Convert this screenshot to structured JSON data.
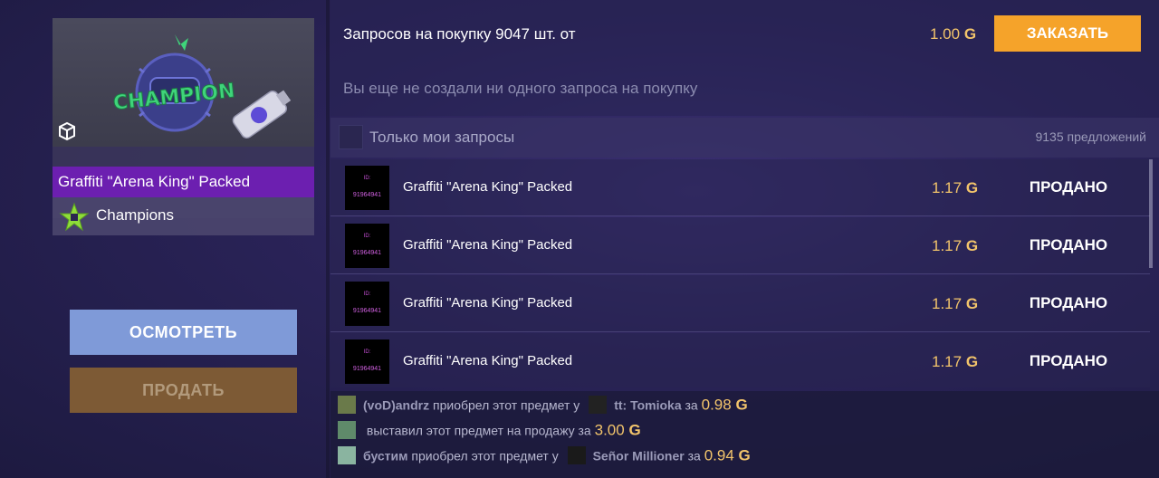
{
  "item": {
    "name": "Graffiti \"Arena King\" Packed",
    "collection": "Champions",
    "image_text": "CHAMPION"
  },
  "buttons": {
    "inspect": "ОСМОТРЕТЬ",
    "sell": "ПРОДАТЬ",
    "order": "ЗАКАЗАТЬ"
  },
  "request": {
    "label": "Запросов на покупку 9047 шт. от",
    "price": "1.00",
    "empty_text": "Вы еще не создали ни одного запроса на покупку"
  },
  "filter": {
    "label": "Только мои запросы",
    "offers_count": "9135 предложений"
  },
  "currency_symbol": "G",
  "colors": {
    "accent_orange": "#f5a32a",
    "gold": "#f2c46b",
    "rarity_purple": "#6c1fb0"
  },
  "listings": [
    {
      "thumb_id_label": "ID:",
      "thumb_id": "91964941",
      "name": "Graffiti \"Arena King\" Packed",
      "price": "1.17",
      "status": "ПРОДАНО"
    },
    {
      "thumb_id_label": "ID:",
      "thumb_id": "91964941",
      "name": "Graffiti \"Arena King\" Packed",
      "price": "1.17",
      "status": "ПРОДАНО"
    },
    {
      "thumb_id_label": "ID:",
      "thumb_id": "91964941",
      "name": "Graffiti \"Arena King\" Packed",
      "price": "1.17",
      "status": "ПРОДАНО"
    },
    {
      "thumb_id_label": "ID:",
      "thumb_id": "91964941",
      "name": "Graffiti \"Arena King\" Packed",
      "price": "1.17",
      "status": "ПРОДАНО"
    }
  ],
  "history": [
    {
      "user": "(voD)andrz",
      "action": "приобрел этот предмет у",
      "seller": "tt: Tomioka",
      "for_word": "за",
      "price": "0.98"
    },
    {
      "user": "",
      "action": "выставил этот предмет на продажу за",
      "price": "3.00"
    },
    {
      "user": "бустим",
      "action": "приобрел этот предмет у",
      "seller": "Señor Millioner",
      "for_word": "за",
      "price": "0.94"
    }
  ]
}
